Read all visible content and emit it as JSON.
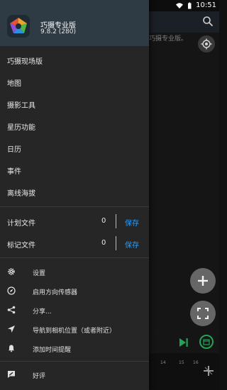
{
  "status_bar": {
    "time": "10:51"
  },
  "background": {
    "hint_text": "巧摄专业版。",
    "timeline_ticks": [
      "14",
      "15",
      "16"
    ]
  },
  "drawer": {
    "app_name": "巧摄专业版",
    "app_version": "9.8.2 (280)",
    "menu": [
      {
        "label": "巧摄现场版"
      },
      {
        "label": "地图"
      },
      {
        "label": "摄影工具"
      },
      {
        "label": "星历功能"
      },
      {
        "label": "日历"
      },
      {
        "label": "事件"
      },
      {
        "label": "离线海拔"
      }
    ],
    "files": [
      {
        "label": "计划文件",
        "count": "0",
        "action": "保存"
      },
      {
        "label": "标记文件",
        "count": "0",
        "action": "保存"
      }
    ],
    "actions": [
      {
        "icon": "gear-icon",
        "label": "设置"
      },
      {
        "icon": "compass-icon",
        "label": "启用方向传感器"
      },
      {
        "icon": "share-icon",
        "label": "分享..."
      },
      {
        "icon": "navigation-arrow-icon",
        "label": "导航到相机位置（或者附近）"
      },
      {
        "icon": "bell-icon",
        "label": "添加时间提醒"
      }
    ],
    "review": {
      "icon": "rate-review-icon",
      "label": "好评"
    }
  },
  "colors": {
    "drawer_bg": "#262626",
    "header_bg": "#2e3a44",
    "accent_blue": "#2f9df5",
    "accent_green": "#23a455"
  }
}
